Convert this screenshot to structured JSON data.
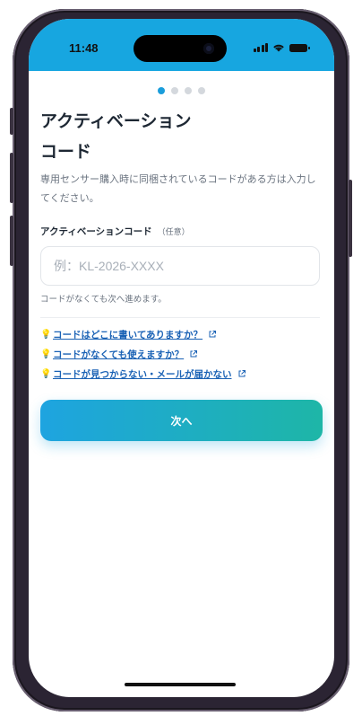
{
  "status_bar": {
    "time": "11:48",
    "background_color": "#17a6e0"
  },
  "progress": {
    "total_steps": 4,
    "current_step": 1
  },
  "screen": {
    "title_line1": "アクティベーション",
    "title_line2": "コード",
    "subtitle": "専用センサー購入時に同梱されているコードがある方は入力してください。",
    "field_label": "アクティベーションコード",
    "field_optional": "（任意）",
    "input_value": "",
    "input_placeholder": "例：KL-2026-XXXX",
    "hint": "コードがなくても次へ進めます。"
  },
  "help_links": [
    {
      "label": "コードはどこに書いてありますか？",
      "icon": "lightbulb-icon",
      "trailing_icon": "external-link-icon"
    },
    {
      "label": "コードがなくても使えますか？",
      "icon": "lightbulb-icon",
      "trailing_icon": "external-link-icon"
    },
    {
      "label": "コードが見つからない・メールが届かない",
      "icon": "lightbulb-icon",
      "trailing_icon": "external-link-icon"
    }
  ],
  "actions": {
    "next_label": "次へ",
    "gradient_start": "#1ea4e0",
    "gradient_end": "#1eb6a7"
  },
  "colors": {
    "link": "#1a62b5",
    "active_dot": "#1a9ddb"
  }
}
